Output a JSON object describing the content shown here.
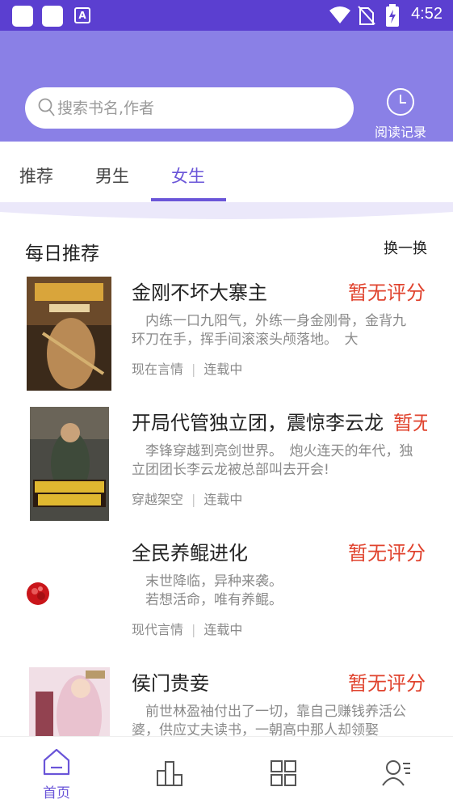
{
  "status_bar": {
    "time": "4:52",
    "icons": [
      "notification-square-icon",
      "notification-square-icon",
      "a-icon",
      "wifi-icon",
      "no-sim-icon",
      "battery-charging-icon"
    ]
  },
  "search": {
    "placeholder": "搜索书名,作者",
    "value": ""
  },
  "history": {
    "label": "阅读记录",
    "icon": "clock-icon"
  },
  "tabs": [
    {
      "label": "推荐",
      "active": false
    },
    {
      "label": "男生",
      "active": false
    },
    {
      "label": "女生",
      "active": true
    }
  ],
  "section": {
    "title": "每日推荐",
    "refresh_label": "换一换"
  },
  "books": [
    {
      "title": "金刚不坏大寨主",
      "rating": "暂无评分",
      "description": "　内练一口九阳气，外练一身金刚骨，金背九环刀在手，挥手间滚滚头颅落地。　大",
      "genre": "现在言情",
      "status": "连载中"
    },
    {
      "title": "开局代管独立团，震惊李云龙",
      "rating": "暂无评分",
      "description": "　李锋穿越到亮剑世界。　炮火连天的年代，独立团团长李云龙被总部叫去开会!",
      "genre": "穿越架空",
      "status": "连载中"
    },
    {
      "title": "全民养鲲进化",
      "rating": "暂无评分",
      "description": "　末世降临，异种来袭。\n　若想活命，唯有养鲲。",
      "genre": "现代言情",
      "status": "连载中"
    },
    {
      "title": "侯门贵妾",
      "rating": "暂无评分",
      "description": "　前世林盈袖付出了一切，靠自己赚钱养活公婆，供应丈夫读书，一朝高中那人却领娶",
      "genre": "",
      "status": ""
    }
  ],
  "bottom_nav": [
    {
      "label": "首页",
      "icon": "home-icon",
      "active": true
    },
    {
      "label": "",
      "icon": "ranking-icon",
      "active": false
    },
    {
      "label": "",
      "icon": "category-grid-icon",
      "active": false
    },
    {
      "label": "",
      "icon": "profile-icon",
      "active": false
    }
  ],
  "colors": {
    "status_bar": "#5b3fd0",
    "header": "#8a80e6",
    "accent": "#6a55d8",
    "rating": "#e0432e"
  }
}
